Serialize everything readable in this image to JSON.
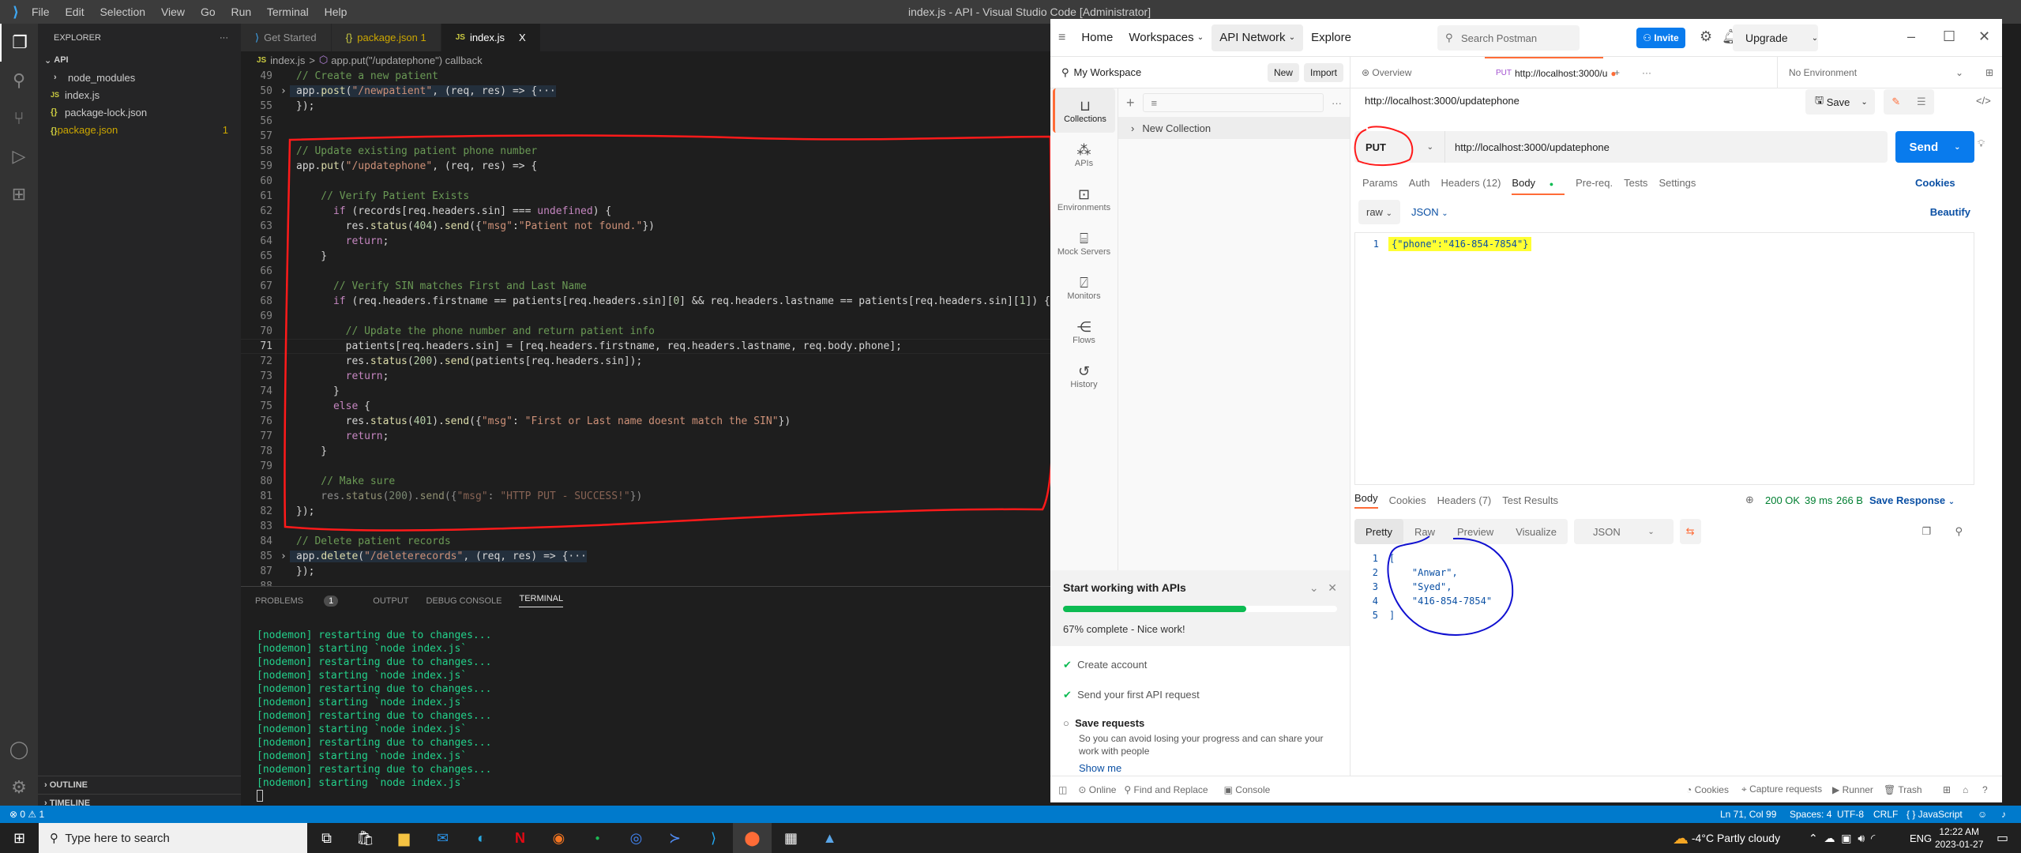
{
  "vscode": {
    "window_title": "index.js - API - Visual Studio Code [Administrator]",
    "menu": [
      "File",
      "Edit",
      "Selection",
      "View",
      "Go",
      "Run",
      "Terminal",
      "Help"
    ],
    "explorer": {
      "title": "EXPLORER",
      "more": "···",
      "root": "API",
      "items": [
        {
          "icon": ">",
          "name": "node_modules",
          "badge": ""
        },
        {
          "icon": "JS",
          "name": "index.js",
          "badge": ""
        },
        {
          "icon": "{}",
          "name": "package-lock.json",
          "badge": ""
        },
        {
          "icon": "{}",
          "name": "package.json",
          "badge": "1"
        }
      ],
      "outline": "OUTLINE",
      "timeline": "TIMELINE"
    },
    "tabs": [
      {
        "icon": "vscode",
        "label": "Get Started"
      },
      {
        "icon": "{}",
        "label": "package.json 1"
      },
      {
        "icon": "JS",
        "label": "index.js",
        "close": "X"
      }
    ],
    "breadcrumb": {
      "file": "index.js",
      "sep": ">",
      "symbol": "app.put(\"/updatephone\") callback"
    },
    "code_lines": [
      {
        "n": "49",
        "t": "// Create a new patient"
      },
      {
        "n": "50",
        "t": "app.post(\"/newpatient\", (req, res) => {···"
      },
      {
        "n": "55",
        "t": "});"
      },
      {
        "n": "56",
        "t": ""
      },
      {
        "n": "57",
        "t": ""
      },
      {
        "n": "58",
        "t": "// Update existing patient phone number"
      },
      {
        "n": "59",
        "t": "app.put(\"/updatephone\", (req, res) => {"
      },
      {
        "n": "60",
        "t": ""
      },
      {
        "n": "61",
        "t": "    // Verify Patient Exists"
      },
      {
        "n": "62",
        "t": "      if (records[req.headers.sin] === undefined) {"
      },
      {
        "n": "63",
        "t": "        res.status(404).send({\"msg\":\"Patient not found.\"})"
      },
      {
        "n": "64",
        "t": "        return;"
      },
      {
        "n": "65",
        "t": "    }"
      },
      {
        "n": "66",
        "t": ""
      },
      {
        "n": "67",
        "t": "      // Verify SIN matches First and Last Name"
      },
      {
        "n": "68",
        "t": "      if (req.headers.firstname == patients[req.headers.sin][0] && req.headers.lastname == patients[req.headers.sin][1]) {"
      },
      {
        "n": "69",
        "t": ""
      },
      {
        "n": "70",
        "t": "        // Update the phone number and return patient info"
      },
      {
        "n": "71",
        "t": "        patients[req.headers.sin] = [req.headers.firstname, req.headers.lastname, req.body.phone];"
      },
      {
        "n": "72",
        "t": "        res.status(200).send(patients[req.headers.sin]);"
      },
      {
        "n": "73",
        "t": "        return;"
      },
      {
        "n": "74",
        "t": "      }"
      },
      {
        "n": "75",
        "t": "      else {"
      },
      {
        "n": "76",
        "t": "        res.status(401).send({\"msg\": \"First or Last name doesnt match the SIN\"})"
      },
      {
        "n": "77",
        "t": "        return;"
      },
      {
        "n": "78",
        "t": "    }"
      },
      {
        "n": "79",
        "t": ""
      },
      {
        "n": "80",
        "t": "    // Make sure"
      },
      {
        "n": "81",
        "t": "    res.status(200).send({\"msg\": \"HTTP PUT - SUCCESS!\"})"
      },
      {
        "n": "82",
        "t": "});"
      },
      {
        "n": "83",
        "t": ""
      },
      {
        "n": "84",
        "t": "// Delete patient records"
      },
      {
        "n": "85",
        "t": "app.delete(\"/deleterecords\", (req, res) => {···"
      },
      {
        "n": "87",
        "t": "});"
      },
      {
        "n": "88",
        "t": ""
      }
    ],
    "panel_tabs": [
      {
        "label": "PROBLEMS",
        "badge": "1"
      },
      {
        "label": "OUTPUT"
      },
      {
        "label": "DEBUG CONSOLE"
      },
      {
        "label": "TERMINAL",
        "active": true
      }
    ],
    "terminal_lines": [
      "[nodemon] restarting due to changes...",
      "[nodemon] starting `node index.js`",
      "[nodemon] restarting due to changes...",
      "[nodemon] starting `node index.js`",
      "[nodemon] restarting due to changes...",
      "[nodemon] starting `node index.js`",
      "[nodemon] restarting due to changes...",
      "[nodemon] starting `node index.js`",
      "[nodemon] restarting due to changes...",
      "[nodemon] starting `node index.js`",
      "[nodemon] restarting due to changes...",
      "[nodemon] starting `node index.js`"
    ],
    "status": {
      "errors": "0",
      "warnings": "1",
      "position": "Ln 71, Col 99",
      "spaces": "Spaces: 4",
      "encoding": "UTF-8",
      "eol": "CRLF",
      "language": "{ } JavaScript"
    }
  },
  "postman": {
    "nav": [
      "Home",
      "Workspaces",
      "API Network",
      "Explore"
    ],
    "search_placeholder": "Search Postman",
    "invite": "Invite",
    "upgrade": "Upgrade",
    "workspace": "My Workspace",
    "new_btn": "New",
    "import_btn": "Import",
    "left_nav": [
      "Collections",
      "APIs",
      "Environments",
      "Mock Servers",
      "Monitors",
      "Flows",
      "History"
    ],
    "collection_item": "New Collection",
    "tabs": {
      "overview": "Overview",
      "request_method": "PUT",
      "request_url": "http://localhost:3000/u"
    },
    "environment": "No Environment",
    "request_name": "http://localhost:3000/updatephone",
    "save": "Save",
    "method": "PUT",
    "url": "http://localhost:3000/updatephone",
    "send": "Send",
    "req_tabs": [
      "Params",
      "Auth",
      "Headers (12)",
      "Body",
      "Pre-req.",
      "Tests",
      "Settings"
    ],
    "cookies": "Cookies",
    "body_mode": "raw",
    "body_lang": "JSON",
    "beautify": "Beautify",
    "request_body": "{\"phone\":\"416-854-7854\"}",
    "resp_tabs": [
      "Body",
      "Cookies",
      "Headers (7)",
      "Test Results"
    ],
    "resp_status": "200 OK",
    "resp_time": "39 ms",
    "resp_size": "266 B",
    "save_response": "Save Response",
    "view_modes": [
      "Pretty",
      "Raw",
      "Preview",
      "Visualize"
    ],
    "resp_lang": "JSON",
    "response_lines": [
      "[",
      "    \"Anwar\",",
      "    \"Syed\",",
      "    \"416-854-7854\"",
      "]"
    ],
    "onboarding": {
      "title": "Start working with APIs",
      "progress": 0.67,
      "progress_text": "67% complete - Nice work!",
      "steps": [
        {
          "label": "Create account",
          "done": true
        },
        {
          "label": "Send your first API request",
          "done": true
        },
        {
          "label": "Save requests",
          "done": false,
          "desc": "So you can avoid losing your progress and can share your work with people",
          "link": "Show me"
        }
      ]
    },
    "footer_left": [
      "Online",
      "Find and Replace",
      "Console"
    ],
    "footer_right": [
      "Cookies",
      "Capture requests",
      "Runner",
      "Trash"
    ]
  },
  "taskbar": {
    "search_placeholder": "Type here to search",
    "weather": "-4°C  Partly cloudy",
    "lang": "ENG",
    "time": "12:22 AM",
    "date": "2023-01-27"
  }
}
